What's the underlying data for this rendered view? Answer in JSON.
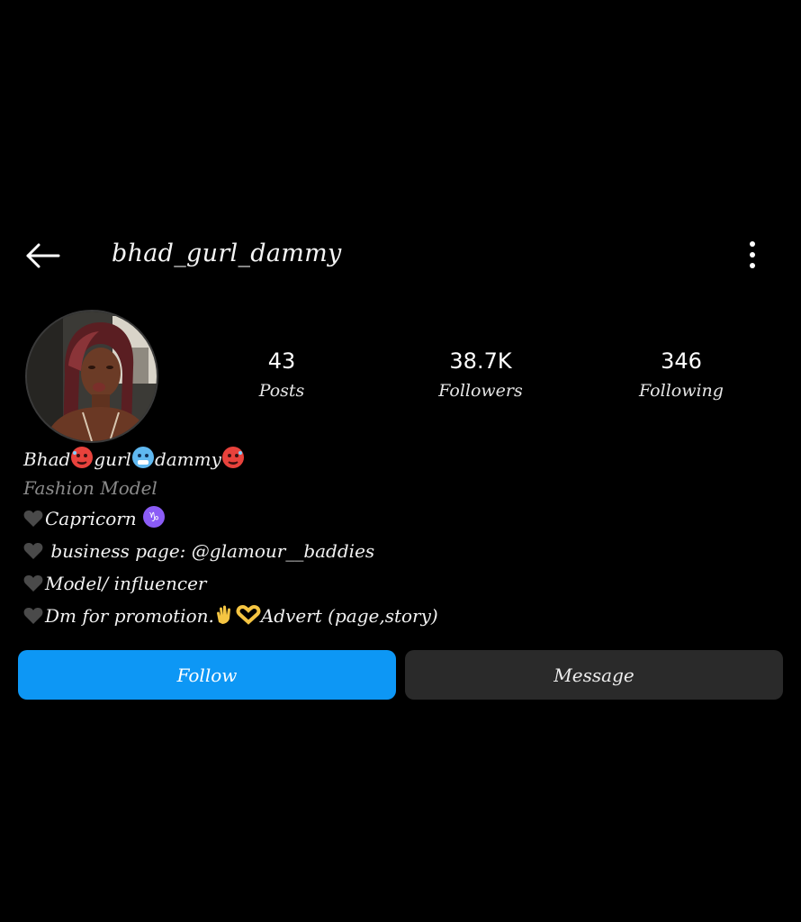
{
  "header": {
    "username": "bhad_gurl_dammy",
    "back_icon": "arrow-left-icon",
    "more_icon": "more-vertical-icon"
  },
  "profile": {
    "avatar_alt": "profile picture"
  },
  "stats": {
    "posts": {
      "value": "43",
      "label": "Posts"
    },
    "followers": {
      "value": "38.7K",
      "label": "Followers"
    },
    "following": {
      "value": "346",
      "label": "Following"
    }
  },
  "bio": {
    "name_parts": [
      "Bhad",
      "gurl",
      "dammy"
    ],
    "category": "Fashion Model",
    "line1": "Capricorn",
    "line2": " business page: @glamour__baddies",
    "line3": "Model/ influencer",
    "line4_a": "Dm for promotion.",
    "line4_b": "Advert (page,story)"
  },
  "actions": {
    "follow_label": "Follow",
    "message_label": "Message"
  },
  "colors": {
    "background": "#000000",
    "follow_button": "#0d97f5",
    "message_button": "#2a2a2a",
    "category_text": "#8a8a8a"
  }
}
